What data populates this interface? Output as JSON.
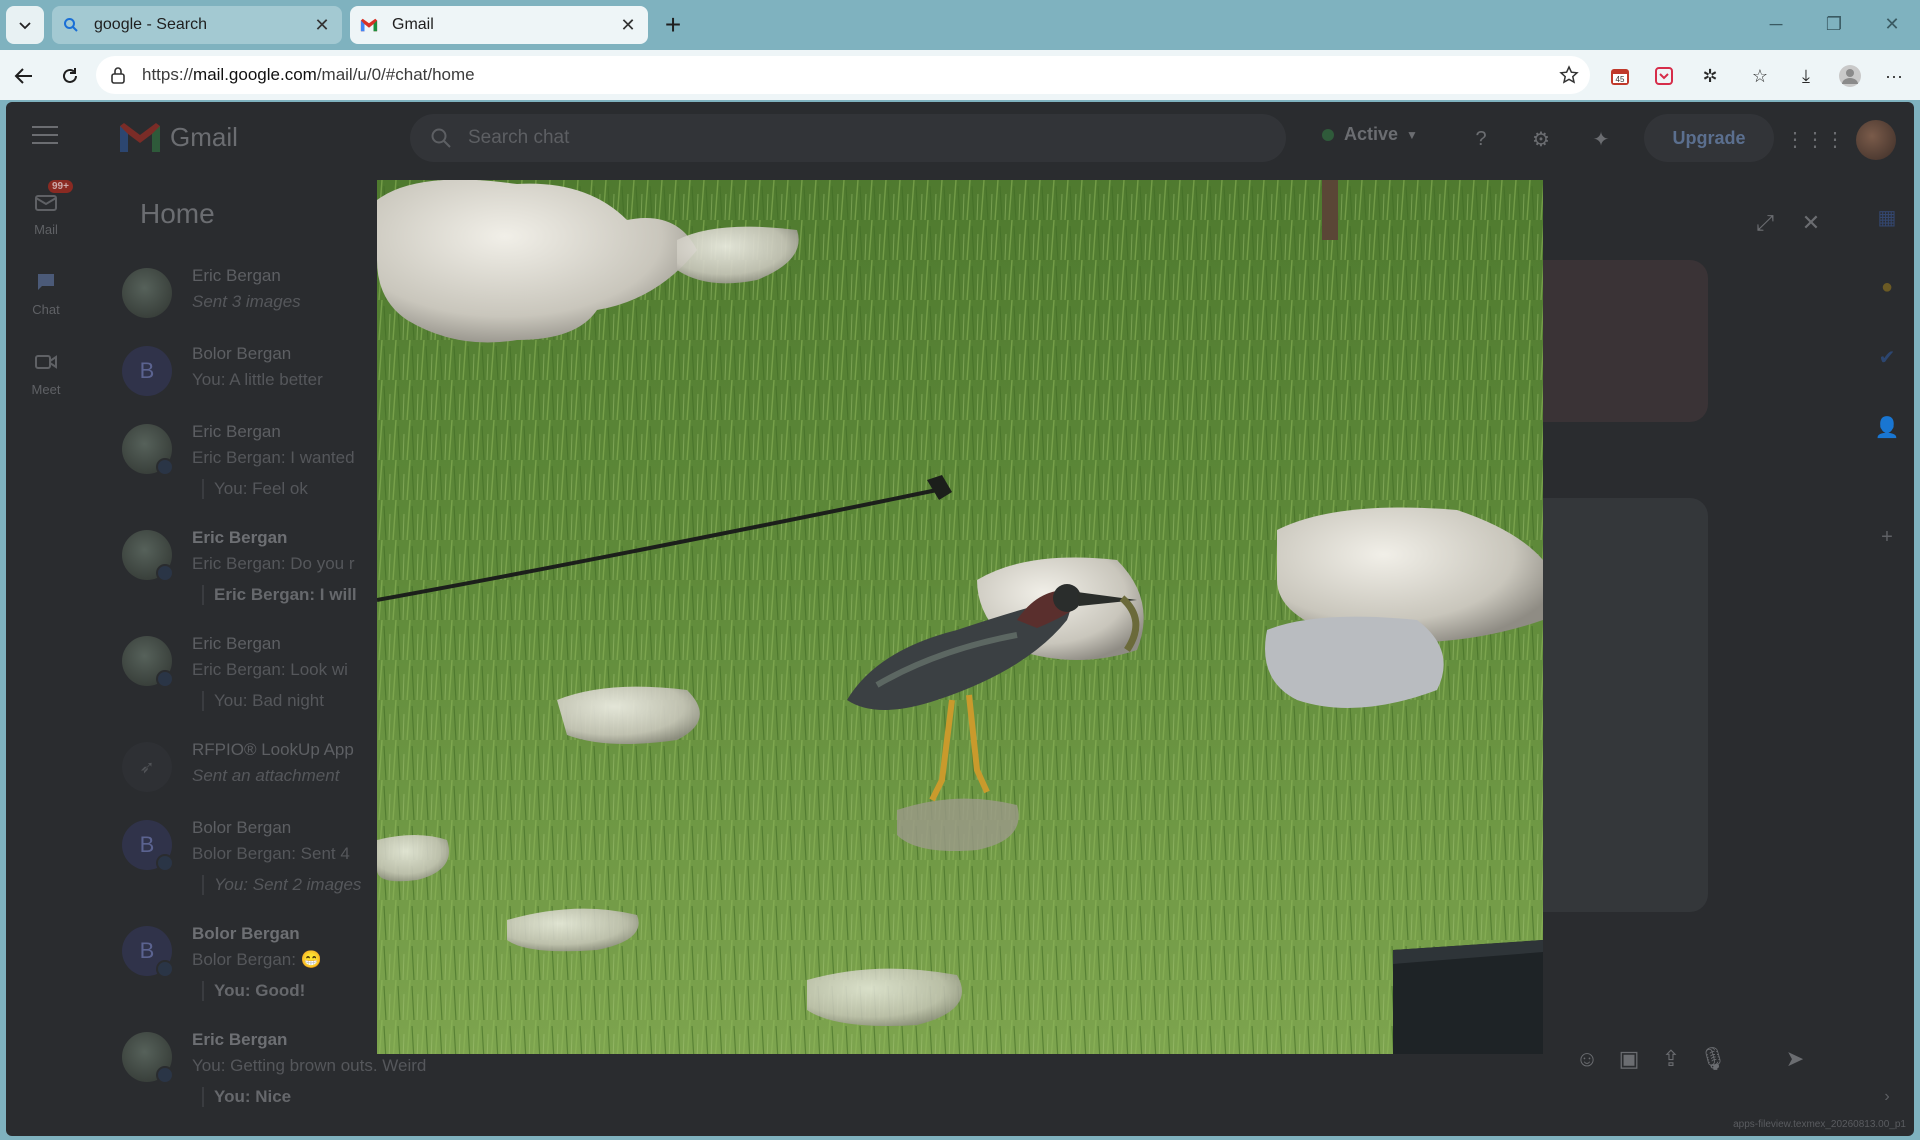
{
  "browser": {
    "tabs": [
      {
        "title": "google - Search",
        "favicon": "search-icon",
        "active": false
      },
      {
        "title": "Gmail",
        "favicon": "gmail-icon",
        "active": true
      }
    ],
    "url_prefix": "https://",
    "url_host": "mail.google.com",
    "url_path": "/mail/u/0/#chat/home",
    "extension_badge": "45"
  },
  "gmail": {
    "app_name": "Gmail",
    "search_placeholder": "Search chat",
    "status": "Active",
    "upgrade_label": "Upgrade",
    "rail": [
      {
        "label": "Mail",
        "icon": "mail-icon",
        "badge": "99+"
      },
      {
        "label": "Chat",
        "icon": "chat-icon"
      },
      {
        "label": "Meet",
        "icon": "meet-icon"
      }
    ],
    "home_title": "Home",
    "conversations": [
      {
        "name": "Eric Bergan",
        "preview": "Sent 3 images",
        "preview_italic": true,
        "reply": "",
        "bold": false,
        "avatar": "photo"
      },
      {
        "name": "Bolor Bergan",
        "preview": "You: A little better",
        "reply": "",
        "bold": false,
        "avatar": "B"
      },
      {
        "name": "Eric Bergan",
        "preview": "Eric Bergan: I wanted",
        "reply": "You: Feel ok",
        "bold": false,
        "avatar": "photo"
      },
      {
        "name": "Eric Bergan",
        "preview": "Eric Bergan: Do you r",
        "reply": "Eric Bergan: I will",
        "bold": true,
        "avatar": "photo"
      },
      {
        "name": "Eric Bergan",
        "preview": "Eric Bergan: Look wi",
        "reply": "You: Bad night",
        "bold": false,
        "avatar": "photo"
      },
      {
        "name": "RFPIO® LookUp  App",
        "preview": "Sent an attachment",
        "preview_italic": true,
        "reply": "",
        "bold": false,
        "avatar": "app"
      },
      {
        "name": "Bolor Bergan",
        "preview": "Bolor Bergan: Sent 4",
        "reply": "You: Sent 2 images",
        "bold": false,
        "avatar": "B"
      },
      {
        "name": "Bolor Bergan",
        "preview": "Bolor Bergan: 😁",
        "reply": "You: Good!",
        "bold": true,
        "avatar": "B"
      },
      {
        "name": "Eric Bergan",
        "preview": "You: Getting brown outs. Weird",
        "reply": "You: Nice",
        "bold": true,
        "avatar": "photo"
      }
    ],
    "watermark": "apps-fileview.texmex_20260813.00_p1"
  },
  "viewer": {
    "subject": "photo of a green heron with a fish in grass among rocks"
  },
  "colors": {
    "tabstrip": "#7fb2bf",
    "toolbar": "#eef5f7",
    "page_dim": "#2a2c2f",
    "grass": "#5f8a3a"
  }
}
